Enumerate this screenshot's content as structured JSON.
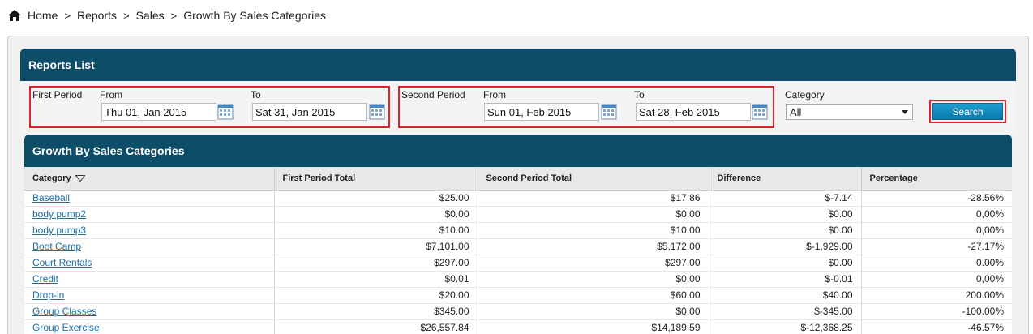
{
  "breadcrumb": {
    "items": [
      "Home",
      "Reports",
      "Sales",
      "Growth By Sales Categories"
    ],
    "separator": ">"
  },
  "reports_list": {
    "title": "Reports List"
  },
  "filters": {
    "first_period": {
      "label": "First Period",
      "from_label": "From",
      "from_value": "Thu 01, Jan 2015",
      "to_label": "To",
      "to_value": "Sat 31, Jan 2015"
    },
    "second_period": {
      "label": "Second Period",
      "from_label": "From",
      "from_value": "Sun 01, Feb 2015",
      "to_label": "To",
      "to_value": "Sat 28, Feb 2015"
    },
    "category": {
      "label": "Category",
      "selected": "All"
    },
    "search_label": "Search"
  },
  "growth": {
    "title": "Growth By Sales Categories",
    "columns": [
      "Category",
      "First Period Total",
      "Second Period Total",
      "Difference",
      "Percentage"
    ],
    "rows": [
      [
        "Baseball",
        "$25.00",
        "$17.86",
        "$-7.14",
        "-28.56%"
      ],
      [
        "body pump2",
        "$0.00",
        "$0.00",
        "$0.00",
        "0,00%"
      ],
      [
        "body pump3",
        "$10.00",
        "$10.00",
        "$0.00",
        "0,00%"
      ],
      [
        "Boot Camp",
        "$7,101.00",
        "$5,172.00",
        "$-1,929.00",
        "-27.17%"
      ],
      [
        "Court Rentals",
        "$297.00",
        "$297.00",
        "$0.00",
        "0.00%"
      ],
      [
        "Credit",
        "$0.01",
        "$0.00",
        "$-0.01",
        "0,00%"
      ],
      [
        "Drop-in",
        "$20.00",
        "$60.00",
        "$40.00",
        "200.00%"
      ],
      [
        "Group Classes",
        "$345.00",
        "$0.00",
        "$-345.00",
        "-100.00%"
      ],
      [
        "Group Exercise",
        "$26,557.84",
        "$14,189.59",
        "$-12,368.25",
        "-46.57%"
      ]
    ]
  },
  "colors": {
    "header_bg": "#0e4d68",
    "highlight": "#e0232d",
    "link": "#1a6fa8",
    "button": "#0c77a8"
  }
}
